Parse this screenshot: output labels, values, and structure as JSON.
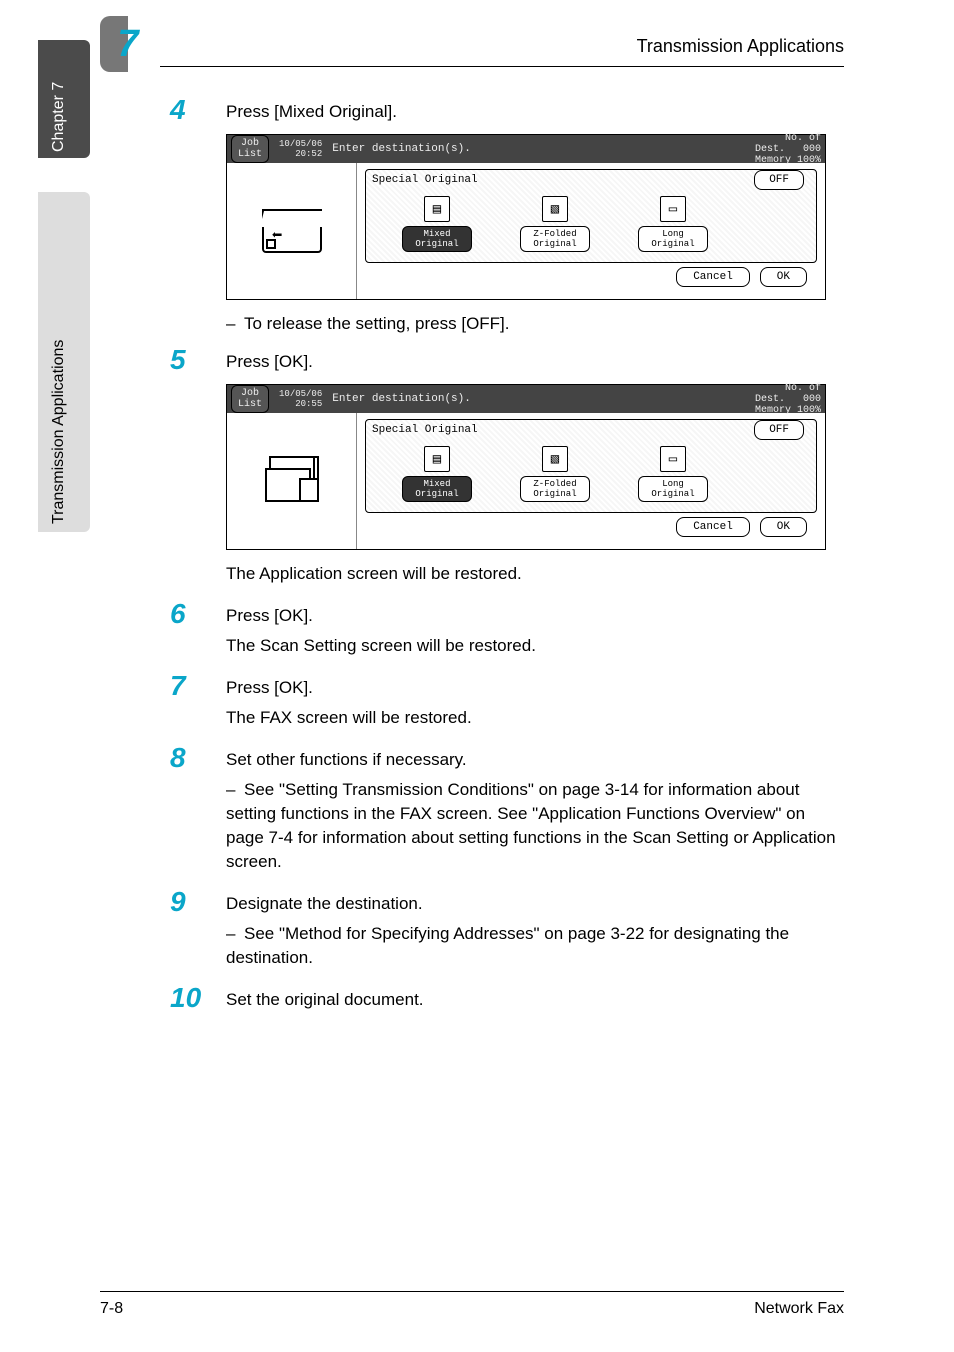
{
  "sidebar": {
    "chapter": "Chapter 7",
    "title": "Transmission Applications"
  },
  "badge": {
    "num": "7"
  },
  "header": {
    "text": "Transmission Applications"
  },
  "steps": {
    "s4": {
      "num": "4",
      "text": "Press [Mixed Original]."
    },
    "s4_sub": "To release the setting, press [OFF].",
    "s5": {
      "num": "5",
      "text": "Press [OK]."
    },
    "s5_after": "The Application screen will be restored.",
    "s6": {
      "num": "6",
      "text": "Press [OK].",
      "after": "The Scan Setting screen will be restored."
    },
    "s7": {
      "num": "7",
      "text": "Press [OK].",
      "after": "The FAX screen will be restored."
    },
    "s8": {
      "num": "8",
      "text": "Set other functions if necessary.",
      "sub": "See \"Setting Transmission Conditions\" on page 3-14 for information about setting functions in the FAX screen. See \"Application Functions Overview\" on page 7-4 for information about setting functions in the Scan Setting or Application screen."
    },
    "s9": {
      "num": "9",
      "text": "Designate the destination.",
      "sub": "See \"Method for Specifying Addresses\" on page 3-22 for designating the destination."
    },
    "s10": {
      "num": "10",
      "text": "Set the original document."
    }
  },
  "lcd1": {
    "job": "Job\nList",
    "date": "10/05/06",
    "time": "20:52",
    "enter": "Enter destination(s).",
    "dest_lbl": "No. of\nDest.",
    "dest_cnt": "000",
    "mem": "Memory 100%",
    "group": "Special Original",
    "off": "OFF",
    "mode1": "Mixed\nOriginal",
    "mode2": "Z-Folded\nOriginal",
    "mode3": "Long\nOriginal",
    "cancel": "Cancel",
    "ok": "OK"
  },
  "lcd2": {
    "job": "Job\nList",
    "date": "10/05/06",
    "time": "20:55",
    "enter": "Enter destination(s).",
    "dest_lbl": "No. of\nDest.",
    "dest_cnt": "000",
    "mem": "Memory 100%",
    "group": "Special Original",
    "off": "OFF",
    "mode1": "Mixed\nOriginal",
    "mode2": "Z-Folded\nOriginal",
    "mode3": "Long\nOriginal",
    "cancel": "Cancel",
    "ok": "OK"
  },
  "footer": {
    "left": "7-8",
    "right": "Network Fax"
  }
}
